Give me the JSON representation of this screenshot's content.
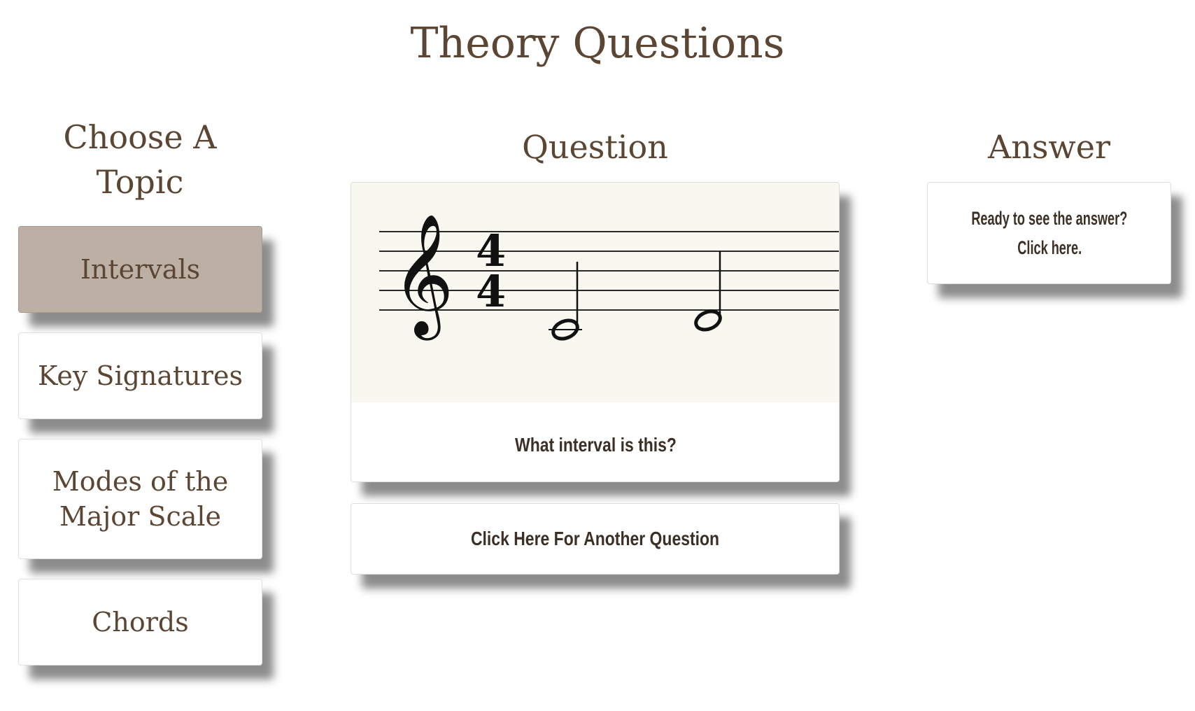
{
  "page": {
    "title": "Theory Questions"
  },
  "topics": {
    "heading": "Choose A Topic",
    "items": [
      {
        "label": "Intervals",
        "active": true
      },
      {
        "label": "Key Signatures",
        "active": false
      },
      {
        "label": "Modes of the Major Scale",
        "active": false
      },
      {
        "label": "Chords",
        "active": false
      }
    ]
  },
  "question": {
    "heading": "Question",
    "prompt": "What interval is this?",
    "time_signature": {
      "top": "4",
      "bottom": "4"
    },
    "another_label": "Click Here For Another Question"
  },
  "answer": {
    "heading": "Answer",
    "reveal_line1": "Ready to see the answer?",
    "reveal_line2": "Click here."
  },
  "colors": {
    "heading_text": "#5b4634",
    "active_topic_bg": "#bcb0a4",
    "staff_bg": "#f8f7f0",
    "button_text": "#3c2f24"
  }
}
